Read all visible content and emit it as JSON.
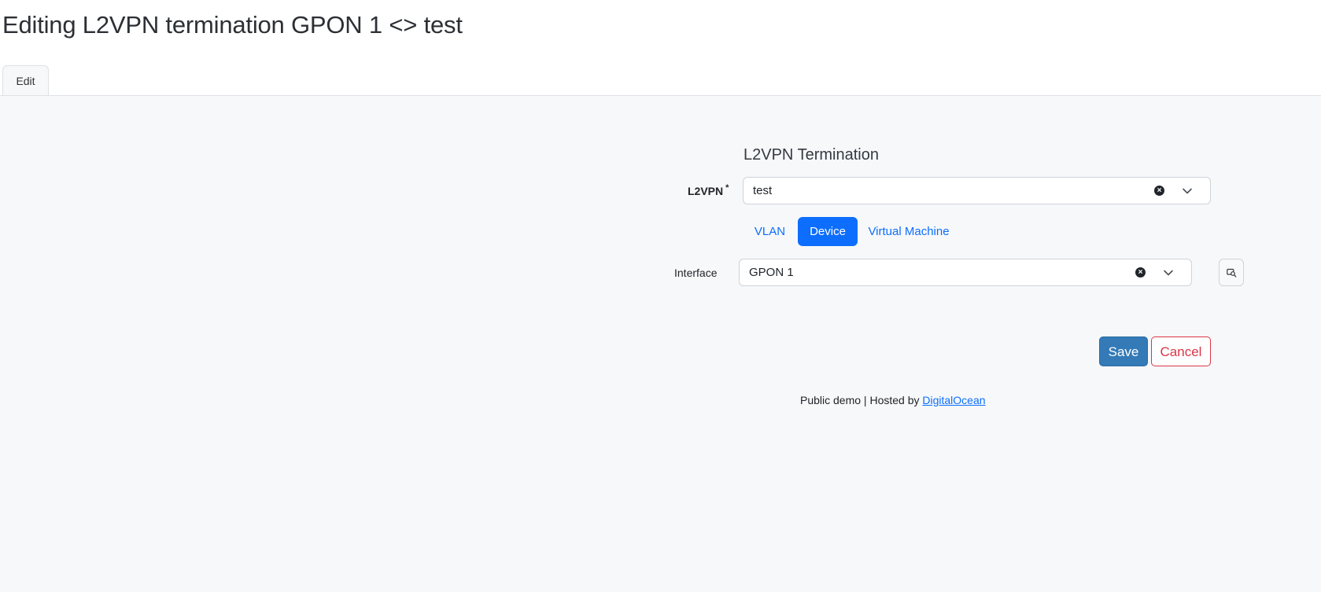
{
  "header": {
    "title": "Editing L2VPN termination GPON 1 <> test",
    "tabs": [
      {
        "label": "Edit",
        "active": true
      }
    ]
  },
  "form": {
    "section_title": "L2VPN Termination",
    "l2vpn": {
      "label": "L2VPN",
      "required_marker": "*",
      "value": "test"
    },
    "assignment_tabs": [
      {
        "label": "VLAN",
        "active": false
      },
      {
        "label": "Device",
        "active": true
      },
      {
        "label": "Virtual Machine",
        "active": false
      }
    ],
    "interface": {
      "label": "Interface",
      "value": "GPON 1"
    }
  },
  "actions": {
    "save_label": "Save",
    "cancel_label": "Cancel"
  },
  "footer": {
    "text": "Public demo | Hosted by ",
    "link_text": "DigitalOcean"
  },
  "colors": {
    "primary": "#0d6efd",
    "save": "#337ab7",
    "cancel": "#dc3545",
    "background": "#f6f8fa"
  },
  "icons": [
    "clear-icon",
    "chevron-down-icon",
    "selector-search-icon"
  ]
}
